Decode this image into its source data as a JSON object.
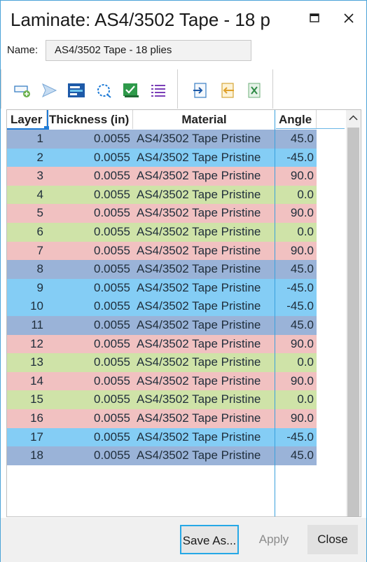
{
  "window": {
    "title": "Laminate: AS4/3502 Tape - 18 p"
  },
  "name_field": {
    "label": "Name:",
    "value": "AS4/3502 Tape - 18 plies"
  },
  "toolbar": {
    "left_group": [
      "add-layer-icon",
      "send-icon",
      "table-icon",
      "refresh-icon",
      "check-icon",
      "list-icon"
    ],
    "right_group": [
      "import-icon",
      "export-icon",
      "excel-icon"
    ]
  },
  "grid": {
    "headers": {
      "layer": "Layer",
      "thickness": "Thickness (in)",
      "material": "Material",
      "angle": "Angle"
    },
    "rows": [
      {
        "layer": "1",
        "thickness": "0.0055",
        "material": "AS4/3502 Tape Pristine",
        "angle": "45.0",
        "color": "#9ab3d8"
      },
      {
        "layer": "2",
        "thickness": "0.0055",
        "material": "AS4/3502 Tape Pristine",
        "angle": "-45.0",
        "color": "#84cdf5"
      },
      {
        "layer": "3",
        "thickness": "0.0055",
        "material": "AS4/3502 Tape Pristine",
        "angle": "90.0",
        "color": "#f1c1c1"
      },
      {
        "layer": "4",
        "thickness": "0.0055",
        "material": "AS4/3502 Tape Pristine",
        "angle": "0.0",
        "color": "#cfe3a8"
      },
      {
        "layer": "5",
        "thickness": "0.0055",
        "material": "AS4/3502 Tape Pristine",
        "angle": "90.0",
        "color": "#f1c1c1"
      },
      {
        "layer": "6",
        "thickness": "0.0055",
        "material": "AS4/3502 Tape Pristine",
        "angle": "0.0",
        "color": "#cfe3a8"
      },
      {
        "layer": "7",
        "thickness": "0.0055",
        "material": "AS4/3502 Tape Pristine",
        "angle": "90.0",
        "color": "#f1c1c1"
      },
      {
        "layer": "8",
        "thickness": "0.0055",
        "material": "AS4/3502 Tape Pristine",
        "angle": "45.0",
        "color": "#9ab3d8"
      },
      {
        "layer": "9",
        "thickness": "0.0055",
        "material": "AS4/3502 Tape Pristine",
        "angle": "-45.0",
        "color": "#84cdf5"
      },
      {
        "layer": "10",
        "thickness": "0.0055",
        "material": "AS4/3502 Tape Pristine",
        "angle": "-45.0",
        "color": "#84cdf5"
      },
      {
        "layer": "11",
        "thickness": "0.0055",
        "material": "AS4/3502 Tape Pristine",
        "angle": "45.0",
        "color": "#9ab3d8"
      },
      {
        "layer": "12",
        "thickness": "0.0055",
        "material": "AS4/3502 Tape Pristine",
        "angle": "90.0",
        "color": "#f1c1c1"
      },
      {
        "layer": "13",
        "thickness": "0.0055",
        "material": "AS4/3502 Tape Pristine",
        "angle": "0.0",
        "color": "#cfe3a8"
      },
      {
        "layer": "14",
        "thickness": "0.0055",
        "material": "AS4/3502 Tape Pristine",
        "angle": "90.0",
        "color": "#f1c1c1"
      },
      {
        "layer": "15",
        "thickness": "0.0055",
        "material": "AS4/3502 Tape Pristine",
        "angle": "0.0",
        "color": "#cfe3a8"
      },
      {
        "layer": "16",
        "thickness": "0.0055",
        "material": "AS4/3502 Tape Pristine",
        "angle": "90.0",
        "color": "#f1c1c1"
      },
      {
        "layer": "17",
        "thickness": "0.0055",
        "material": "AS4/3502 Tape Pristine",
        "angle": "-45.0",
        "color": "#84cdf5"
      },
      {
        "layer": "18",
        "thickness": "0.0055",
        "material": "AS4/3502 Tape Pristine",
        "angle": "45.0",
        "color": "#9ab3d8"
      }
    ]
  },
  "footer": {
    "save_as": "Save As...",
    "apply": "Apply",
    "close": "Close"
  }
}
